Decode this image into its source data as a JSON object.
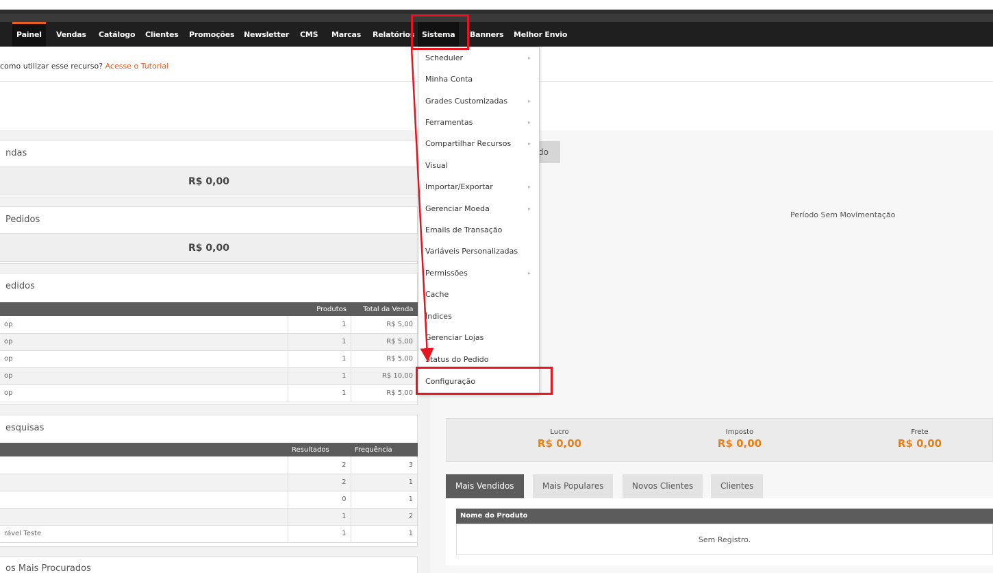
{
  "nav": {
    "items": [
      "Painel",
      "Vendas",
      "Catálogo",
      "Clientes",
      "Promoções",
      "Newsletter",
      "CMS",
      "Marcas",
      "Relatórios",
      "Sistema",
      "Banners",
      "Melhor Envio"
    ],
    "active": "Painel",
    "open": "Sistema"
  },
  "tutorial": {
    "text": "como utilizar esse recurso?",
    "link": "Acesse o Tutorial"
  },
  "panels": {
    "vendas_title": "ndas",
    "vendas_total": "R$ 0,00",
    "pedidos_title": "Pedidos",
    "pedidos_total": "R$ 0,00",
    "ultimos_title": "edidos",
    "pesquisas_title": "esquisas",
    "procurados_title": "os Mais Procurados"
  },
  "orders_table": {
    "headers": [
      "",
      "Produtos",
      "Total da Venda"
    ],
    "rows": [
      [
        "op",
        "1",
        "R$ 5,00"
      ],
      [
        "op",
        "1",
        "R$ 5,00"
      ],
      [
        "op",
        "1",
        "R$ 5,00"
      ],
      [
        "op",
        "1",
        "R$ 10,00"
      ],
      [
        "op",
        "1",
        "R$ 5,00"
      ]
    ]
  },
  "search_table": {
    "headers": [
      "",
      "Resultados",
      "Frequência"
    ],
    "rows": [
      [
        "",
        "2",
        "3"
      ],
      [
        "",
        "2",
        "1"
      ],
      [
        "",
        "0",
        "1"
      ],
      [
        "",
        "1",
        "2"
      ],
      [
        "rável Teste",
        "1",
        "1"
      ]
    ]
  },
  "chart": {
    "tab_label": "do",
    "empty_text": "Período Sem Movimentação"
  },
  "stats": [
    {
      "label": "Lucro",
      "value": "R$ 0,00"
    },
    {
      "label": "Imposto",
      "value": "R$ 0,00"
    },
    {
      "label": "Frete",
      "value": "R$ 0,00"
    }
  ],
  "tabs": [
    "Mais Vendidos",
    "Mais Populares",
    "Novos Clientes",
    "Clientes"
  ],
  "best_sellers": {
    "header": "Nome do Produto",
    "empty": "Sem Registro."
  },
  "dropdown": {
    "items": [
      {
        "label": "Scheduler",
        "submenu": true
      },
      {
        "label": "Minha Conta",
        "submenu": false
      },
      {
        "label": "Grades Customizadas",
        "submenu": true
      },
      {
        "label": "Ferramentas",
        "submenu": true
      },
      {
        "label": "Compartilhar Recursos",
        "submenu": true
      },
      {
        "label": "Visual",
        "submenu": false
      },
      {
        "label": "Importar/Exportar",
        "submenu": true
      },
      {
        "label": "Gerenciar Moeda",
        "submenu": true
      },
      {
        "label": "Emails de Transação",
        "submenu": false
      },
      {
        "label": "Variáveis Personalizadas",
        "submenu": false
      },
      {
        "label": "Permissões",
        "submenu": true
      },
      {
        "label": "Cache",
        "submenu": false
      },
      {
        "label": "Índices",
        "submenu": false
      },
      {
        "label": "Gerenciar Lojas",
        "submenu": false
      },
      {
        "label": "Status do Pedido",
        "submenu": false
      },
      {
        "label": "Configuração",
        "submenu": false
      }
    ],
    "submenu_glyph": "▸"
  },
  "annotation": {
    "color": "#e5141e"
  },
  "colors": {
    "accent": "#e85f24",
    "value_orange": "#e8801a",
    "header_gray": "#5c5c5c"
  }
}
